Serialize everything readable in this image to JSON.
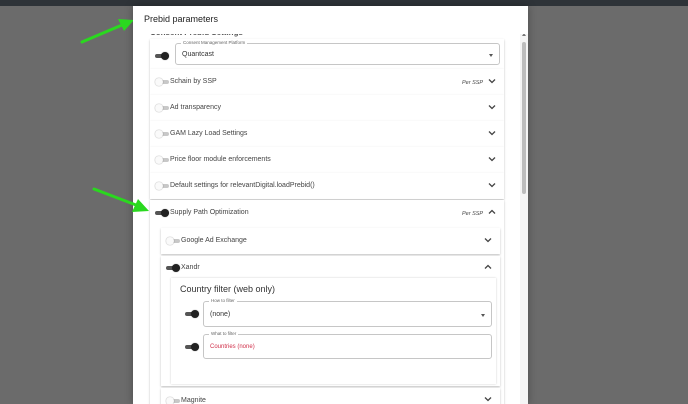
{
  "dialog": {
    "title": "Prebid parameters",
    "section_heading": "Consent Prebid Settings"
  },
  "consent_management": {
    "label": "Consent Management Platform",
    "value": "Quantcast"
  },
  "rows": [
    {
      "label": "Schain by SSP",
      "per_ssp": "Per SSP"
    },
    {
      "label": "Ad transparency"
    },
    {
      "label": "GAM Lazy Load Settings"
    },
    {
      "label": "Price floor module enforcements"
    },
    {
      "label": "Default settings for relevantDigital.loadPrebid()"
    },
    {
      "label": "Supply Path Optimization",
      "per_ssp": "Per SSP"
    }
  ],
  "spo_items": [
    {
      "label": "Google Ad Exchange"
    },
    {
      "label": "Xandr"
    },
    {
      "label": "Magnite"
    }
  ],
  "country_filter": {
    "title": "Country filter (web only)",
    "how_label": "How to filter",
    "how_value": "(none)",
    "what_label": "What to filter",
    "what_value": "Countries (none)"
  },
  "colors": {
    "annotation_arrow": "#2ad81f",
    "accent_red": "#d0304a",
    "topbar": "#2e3338"
  },
  "icons": {
    "chevron_down": "chevron-down-icon",
    "chevron_up": "chevron-up-icon",
    "annotation": "green-arrow-icon"
  }
}
